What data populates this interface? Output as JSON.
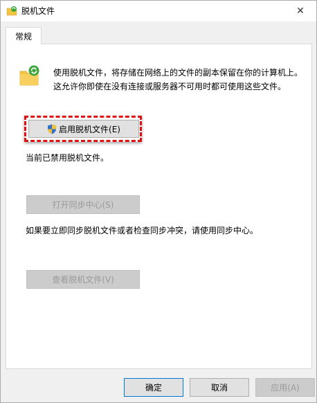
{
  "window": {
    "title": "脱机文件",
    "title_icon": "offline-files-icon",
    "close_glyph": "✕"
  },
  "tabs": [
    {
      "label": "常规",
      "active": true
    }
  ],
  "panel": {
    "description": "使用脱机文件，将存储在网络上的文件的副本保留在你的计算机上。这允许你即使在没有连接或服务器不可用时都可使用这些文件。",
    "enable_button": "启用脱机文件(E)",
    "status_text": "当前已禁用脱机文件。",
    "sync_center_button": "打开同步中心(S)",
    "sync_note": "如果要立即同步脱机文件或者检查同步冲突，请使用同步中心。",
    "view_files_button": "查看脱机文件(V)"
  },
  "footer": {
    "ok": "确定",
    "cancel": "取消",
    "apply": "应用(A)"
  },
  "colors": {
    "highlight": "#e01010",
    "accent": "#0078d7",
    "sync_green": "#3aa63a",
    "folder_yellow": "#f5c542"
  }
}
